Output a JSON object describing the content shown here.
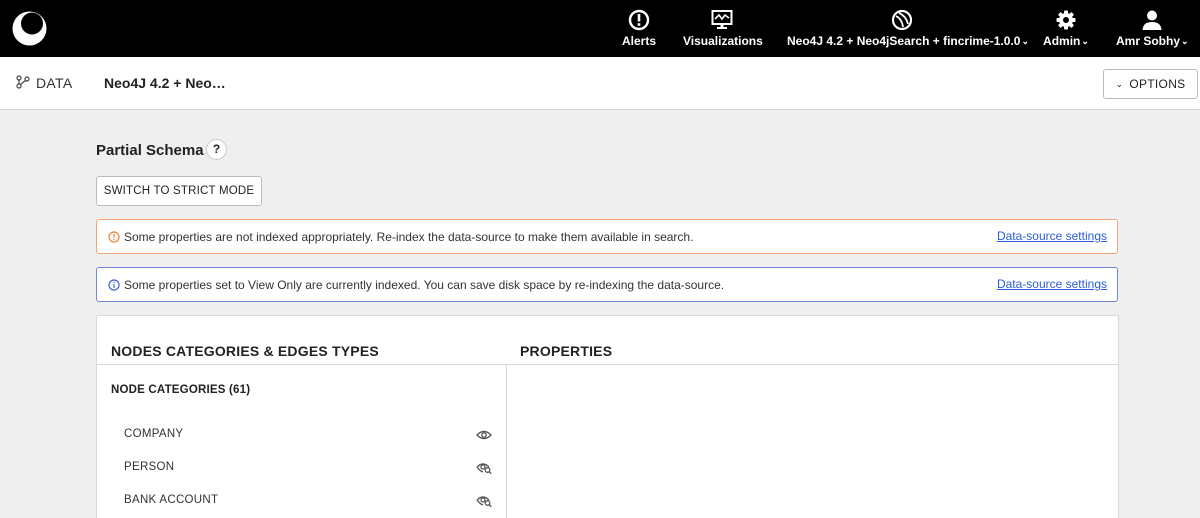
{
  "nav": {
    "logo": "linkurious-logo-icon",
    "items": [
      {
        "label": "Alerts",
        "icon": "alert-circle-icon"
      },
      {
        "label": "Visualizations",
        "icon": "visualizations-monitor-icon"
      },
      {
        "label": "Neo4J 4.2 + Neo4jSearch + fincrime-1.0.0",
        "icon": "datasource-globe-icon"
      },
      {
        "label": "Admin",
        "icon": "gear-icon"
      },
      {
        "label": "Amr Sobhy",
        "icon": "user-icon"
      }
    ]
  },
  "subheader": {
    "section": "DATA",
    "datasource_title": "Neo4J 4.2 + Neo…",
    "options_label": "OPTIONS"
  },
  "schema": {
    "title": "Partial Schema",
    "help": "?",
    "strict_button": "SWITCH TO STRICT MODE"
  },
  "alerts": {
    "warning": {
      "text": "Some properties are not indexed appropriately. Re-index the data-source to make them available in search.",
      "link": "Data-source settings",
      "color": "#f4a372"
    },
    "info": {
      "text": "Some properties set to View Only are currently indexed. You can save disk space by re-indexing the data-source.",
      "link": "Data-source settings",
      "color": "#6f86d6"
    }
  },
  "panel": {
    "left_title": "NODES CATEGORIES & EDGES TYPES",
    "right_title": "PROPERTIES",
    "node_categories_header": "NODE CATEGORIES (61)",
    "nodes": [
      {
        "label": "COMPANY",
        "icon": "eye-icon"
      },
      {
        "label": "PERSON",
        "icon": "eye-search-icon"
      },
      {
        "label": "BANK ACCOUNT",
        "icon": "eye-search-icon"
      }
    ]
  }
}
